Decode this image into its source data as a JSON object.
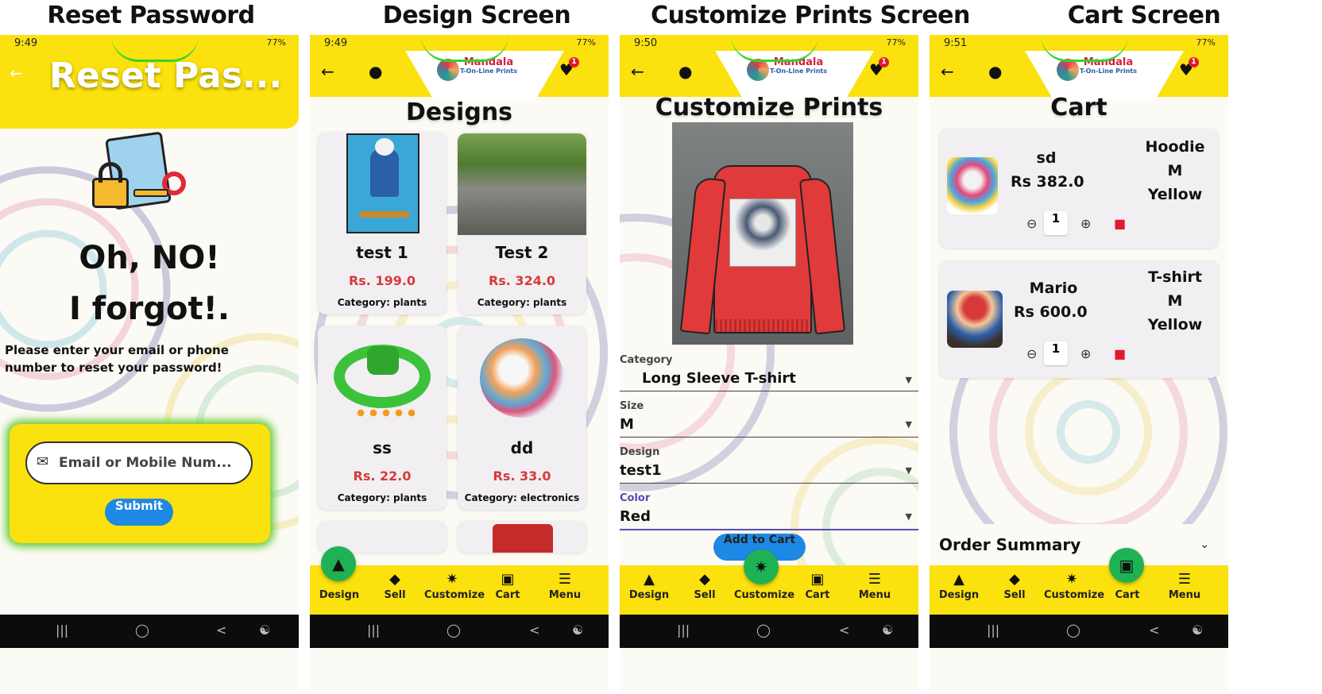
{
  "screen_titles": {
    "reset": "Reset Password",
    "design": "Design Screen",
    "customize": "Customize Prints Screen",
    "cart": "Cart Screen"
  },
  "status_times": {
    "reset": "9:49",
    "design": "9:49",
    "customize": "9:50",
    "cart": "9:51"
  },
  "status_icons": "77%",
  "logo": {
    "title": "Mandala",
    "subtitle": "T-On-Line Prints"
  },
  "heart_badge": "1",
  "reset_screen": {
    "appbar_title": "Reset Pas...",
    "headline_1": "Oh, NO!",
    "headline_2": "I forgot!.",
    "instruction": "Please enter your email or phone number to reset your password!",
    "input_placeholder": "Email or Mobile Num...",
    "submit_label": "Submit"
  },
  "design_screen": {
    "heading": "Designs",
    "items": [
      {
        "name": "test 1",
        "price": "Rs. 199.0",
        "category": "Category: plants",
        "image": "skateboard-figure"
      },
      {
        "name": "Test 2",
        "price": "Rs. 324.0",
        "category": "Category: plants",
        "image": "railway-landscape"
      },
      {
        "name": "ss",
        "price": "Rs. 22.0",
        "category": "Category: plants",
        "image": "green-dragon"
      },
      {
        "name": "dd",
        "price": "Rs. 33.0",
        "category": "Category: electronics",
        "image": "tiger-splash"
      }
    ]
  },
  "customize_screen": {
    "heading": "Customize Prints",
    "fields": [
      {
        "label": "Category",
        "value": "Long Sleeve T-shirt"
      },
      {
        "label": "Size",
        "value": "M"
      },
      {
        "label": "Design",
        "value": "test1"
      },
      {
        "label": "Color",
        "value": "Red"
      }
    ],
    "add_to_cart_label": "Add to Cart",
    "preview_color": "#e03a3a"
  },
  "cart_screen": {
    "heading": "Cart",
    "items": [
      {
        "name": "sd",
        "price": "Rs 382.0",
        "type": "Hoodie",
        "size": "M",
        "color": "Yellow",
        "qty": "1"
      },
      {
        "name": "Mario",
        "price": "Rs 600.0",
        "type": "T-shirt",
        "size": "M",
        "color": "Yellow",
        "qty": "1"
      }
    ],
    "order_summary": "Order Summary"
  },
  "bottom_nav": [
    "Design",
    "Sell",
    "Customize",
    "Cart",
    "Menu"
  ],
  "colors": {
    "accent_yellow": "#fbe10d",
    "fab_green": "#1fb254",
    "price_red": "#d63a3a",
    "submit_blue": "#1e88e5"
  }
}
